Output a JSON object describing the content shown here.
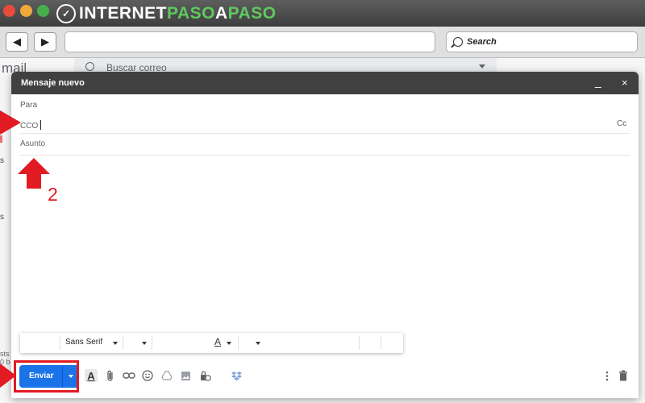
{
  "window": {
    "logo_part1": "INTERNET",
    "logo_part2": "PASO",
    "logo_part3": "A",
    "logo_part4": "PASO"
  },
  "browser": {
    "back_label": "◀",
    "forward_label": "▶",
    "url_value": "",
    "search_placeholder": "Search"
  },
  "gmail": {
    "app_name": "mail",
    "search_placeholder": "Buscar correo",
    "sidebar_fragments": [
      "s",
      "s",
      "sts r\n0 b"
    ]
  },
  "compose": {
    "title": "Mensaje nuevo",
    "minimize_label": "_",
    "close_label": "×",
    "to_label": "Para",
    "bcc_label": "CCO",
    "bcc_value": "",
    "cc_link": "Cc",
    "subject_placeholder": "Asunto",
    "font_name": "Sans Serif",
    "text_color_label": "A",
    "send_label": "Enviar"
  },
  "annotations": {
    "step_number": "2"
  },
  "colors": {
    "accent": "#1a73e8",
    "annotation_red": "#e01b22",
    "compose_header": "#404040",
    "logo_green": "#5ec95e"
  },
  "icons": [
    "format-text-color-icon",
    "attach-icon",
    "link-icon",
    "emoji-icon",
    "drive-icon",
    "photo-icon",
    "confidential-mode-icon",
    "dropbox-icon",
    "more-options-icon",
    "trash-icon"
  ]
}
